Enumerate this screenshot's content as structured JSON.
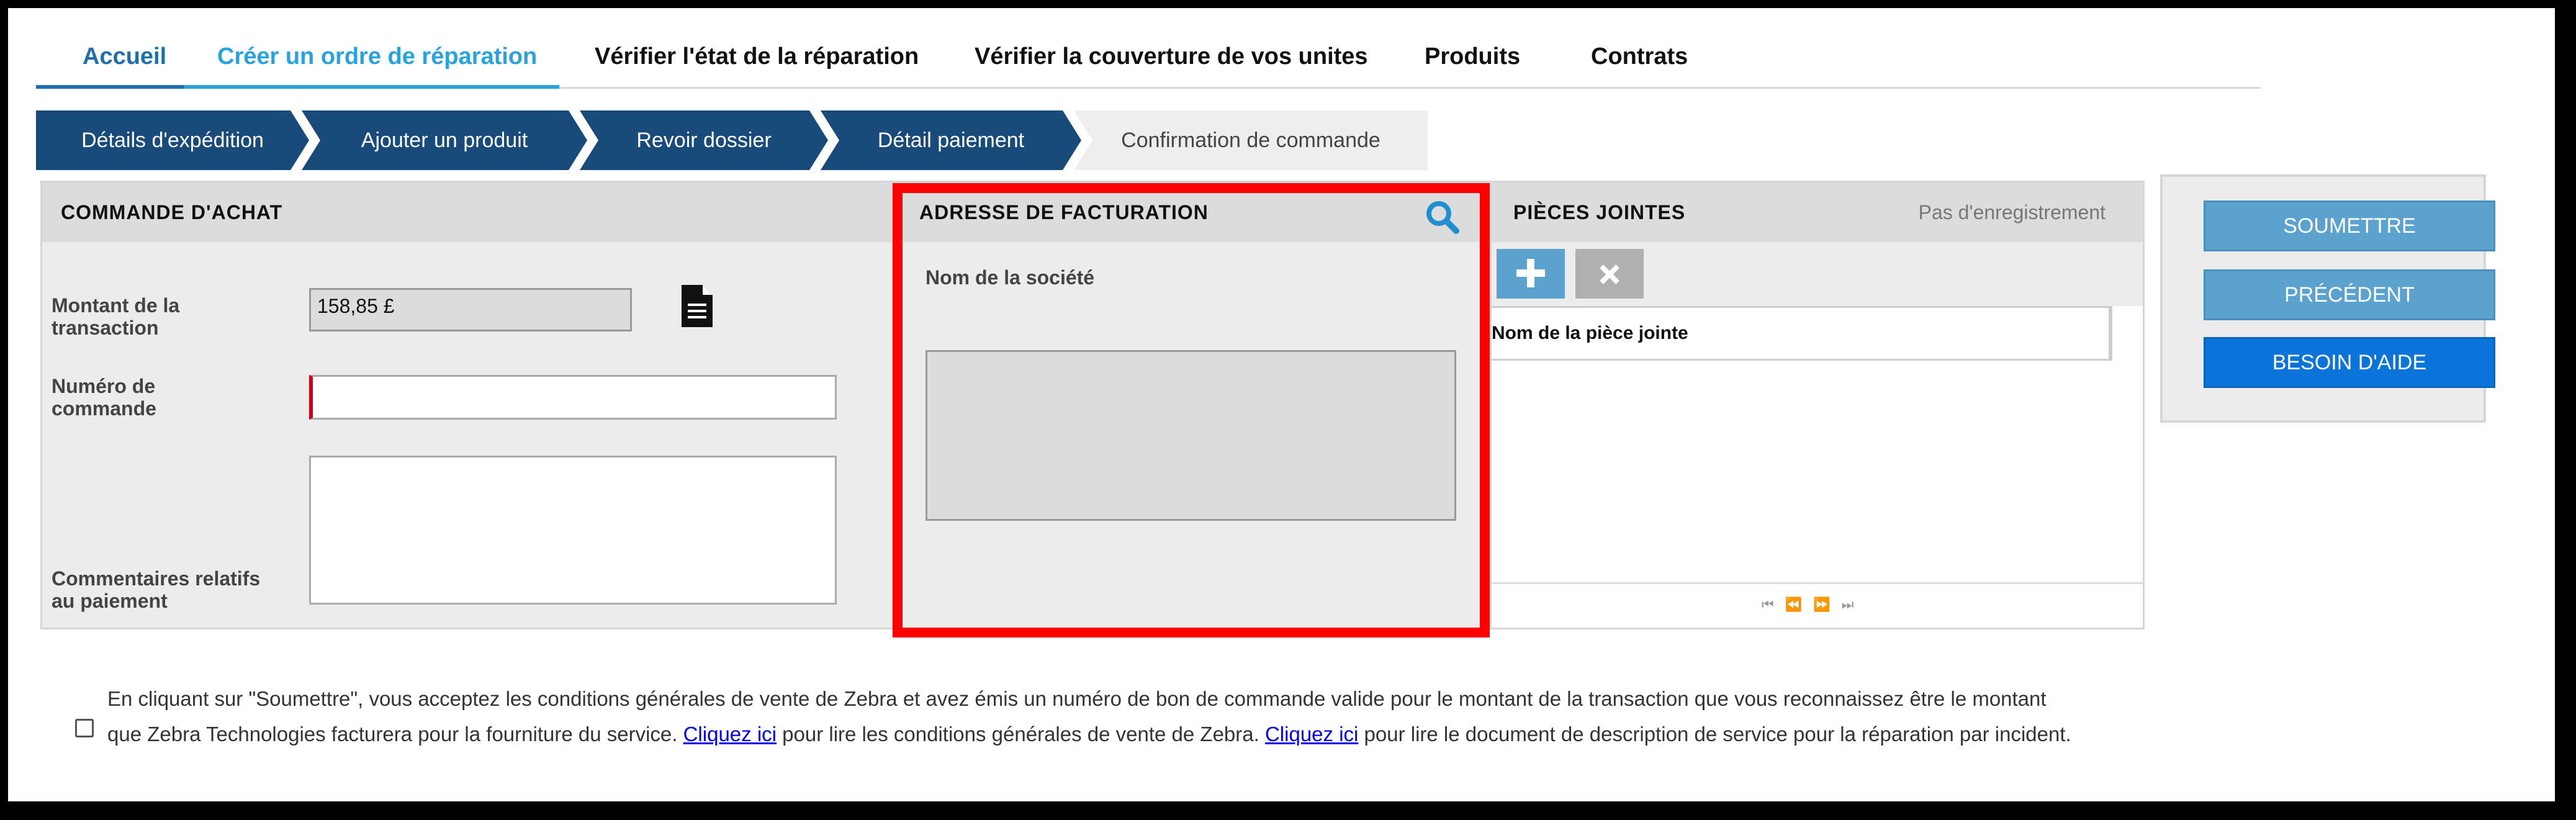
{
  "nav": {
    "tabs": [
      {
        "label": "Accueil"
      },
      {
        "label": "Créer un ordre de réparation"
      },
      {
        "label": "Vérifier l'état de la réparation"
      },
      {
        "label": "Vérifier la couverture de vos unites"
      },
      {
        "label": "Produits"
      },
      {
        "label": "Contrats"
      }
    ],
    "active_tab": "Créer un ordre de réparation"
  },
  "steps": [
    {
      "label": "Détails d'expédition"
    },
    {
      "label": "Ajouter un produit"
    },
    {
      "label": "Revoir dossier"
    },
    {
      "label": "Détail paiement"
    },
    {
      "label": "Confirmation de commande"
    }
  ],
  "purchase_order": {
    "title": "COMMANDE D'ACHAT",
    "amount_label": "Montant de la transaction",
    "amount_value": "158,85 £",
    "order_number_label": "Numéro de commande",
    "order_number_value": "",
    "comments_label": "Commentaires relatifs au paiement",
    "comments_value": ""
  },
  "billing": {
    "title": "ADRESSE DE FACTURATION",
    "company_label": "Nom de la société",
    "company_value": ""
  },
  "attachments": {
    "title": "PIÈCES JOINTES",
    "status": "Pas d'enregistrement",
    "column_header": "Nom de la pièce jointe"
  },
  "actions": {
    "submit": "SOUMETTRE",
    "previous": "PRÉCÉDENT",
    "help": "BESOIN D'AIDE"
  },
  "terms": {
    "line1": "En cliquant sur \"Soumettre\", vous acceptez les conditions générales de vente de Zebra et avez émis un numéro de bon de commande valide pour le montant de la transaction que vous reconnaissez être le montant",
    "line2_a": "que Zebra Technologies facturera pour la fourniture du service. ",
    "link1": "Cliquez ici",
    "line2_b": " pour lire les conditions générales de vente de Zebra. ",
    "link2": "Cliquez ici",
    "line2_c": " pour lire le document de description de service pour la réparation par incident."
  },
  "colors": {
    "nav_blue": "#1f6fae",
    "active_blue": "#29a3df",
    "step_navy": "#184a7a",
    "highlight_red": "#ff0000",
    "help_button": "#0a74da"
  }
}
